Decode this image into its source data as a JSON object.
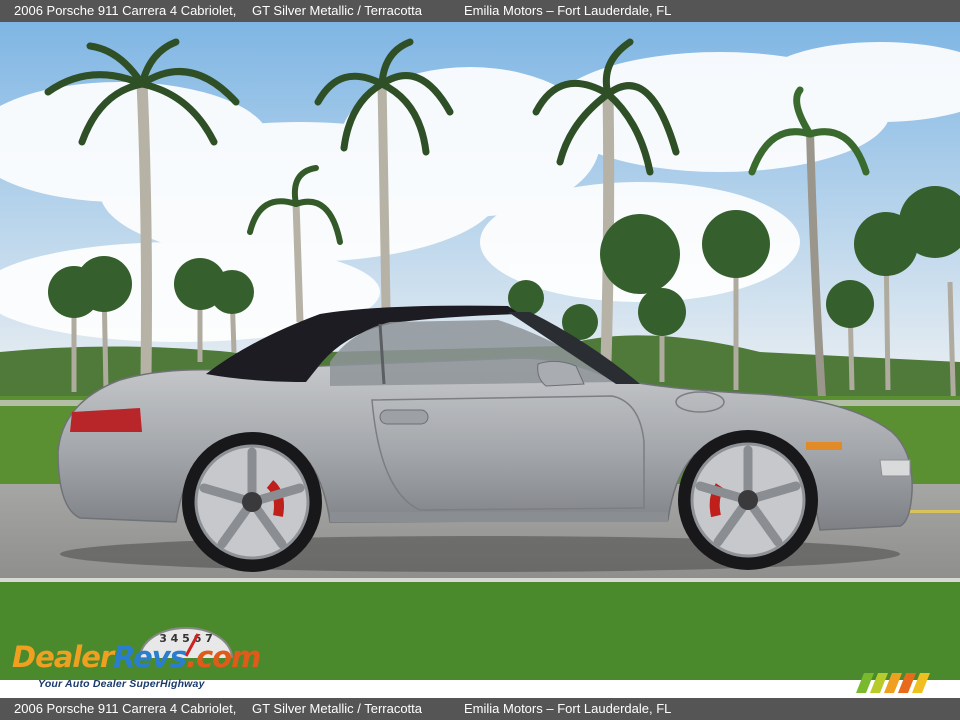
{
  "header": {
    "vehicle": "2006 Porsche 911 Carrera 4 Cabriolet,",
    "colors": "GT Silver Metallic / Terracotta",
    "dealer": "Emilia Motors – Fort Lauderdale, FL"
  },
  "footer": {
    "vehicle": "2006 Porsche 911 Carrera 4 Cabriolet,",
    "colors": "GT Silver Metallic / Terracotta",
    "dealer": "Emilia Motors – Fort Lauderdale, FL"
  },
  "watermark": {
    "part1": "Dealer",
    "part2": "Revs",
    "part3": ".com",
    "tagline": "Your Auto Dealer SuperHighway",
    "gauge_digits": "3 4 5 6 7"
  },
  "colors": {
    "bar_bg": "#555555",
    "car_silver": "#a8aaae",
    "soft_top": "#1c1c22",
    "sky": "#8ec3ea",
    "grass": "#4e8a2e",
    "road": "#9a9a98",
    "caliper": "#c0201c"
  },
  "icons": [
    "dealerrevs-logo",
    "speedometer-gauge-icon",
    "color-stripes-icon"
  ]
}
